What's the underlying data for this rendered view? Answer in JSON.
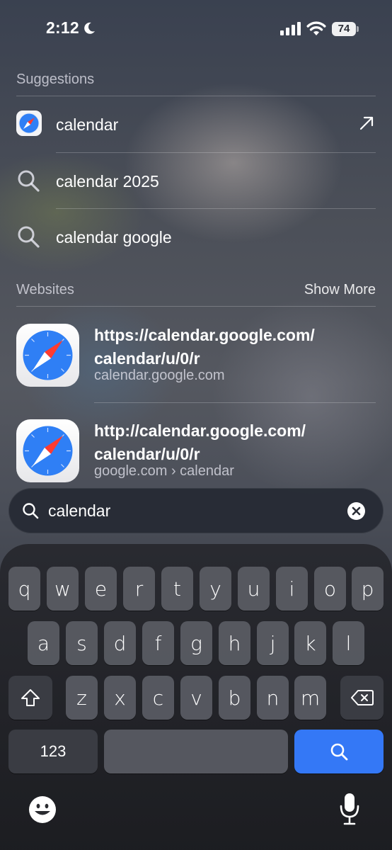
{
  "status_bar": {
    "time": "2:12",
    "battery": "74"
  },
  "suggestions": {
    "header": "Suggestions",
    "items": [
      {
        "label": "calendar",
        "icon": "safari-icon"
      },
      {
        "label": "calendar 2025",
        "icon": "search-icon"
      },
      {
        "label": "calendar google",
        "icon": "search-icon"
      }
    ]
  },
  "websites": {
    "header": "Websites",
    "show_more": "Show More",
    "items": [
      {
        "title_line1": "https://calendar.google.com/",
        "title_line2": "calendar/u/0/r",
        "subtitle": "calendar.google.com"
      },
      {
        "title_line1": "http://calendar.google.com/",
        "title_line2": "calendar/u/0/r",
        "subtitle": "google.com › calendar"
      }
    ]
  },
  "search": {
    "value": "calendar"
  },
  "keyboard": {
    "row1": [
      "q",
      "w",
      "e",
      "r",
      "t",
      "y",
      "u",
      "i",
      "o",
      "p"
    ],
    "row2": [
      "a",
      "s",
      "d",
      "f",
      "g",
      "h",
      "j",
      "k",
      "l"
    ],
    "row3": [
      "z",
      "x",
      "c",
      "v",
      "b",
      "n",
      "m"
    ],
    "numbers_label": "123"
  },
  "colors": {
    "accent_blue": "#3478f6",
    "safari_blue": "#2f7ff5"
  }
}
